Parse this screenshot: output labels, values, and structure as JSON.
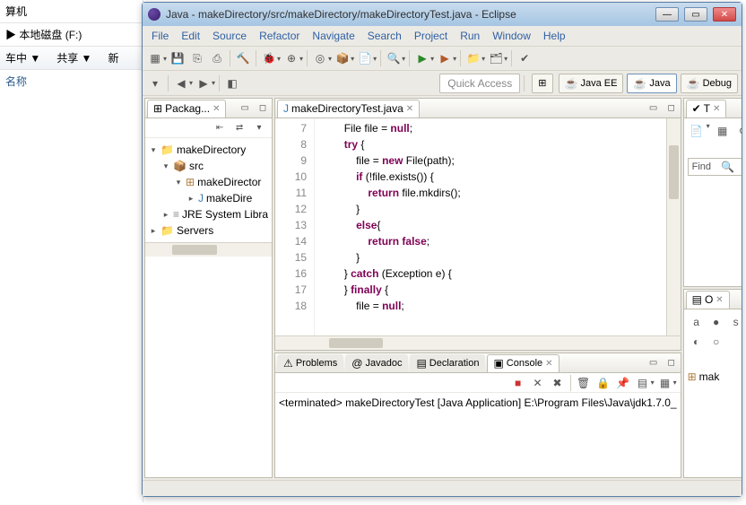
{
  "explorer": {
    "tab1": "算机",
    "breadcrumb_prefix": "▶",
    "breadcrumb": "本地磁盘 (F:)",
    "tool1": "车中 ▼",
    "tool2": "共享 ▼",
    "tool3": "新",
    "header": "名称"
  },
  "eclipse": {
    "title": "Java - makeDirectory/src/makeDirectory/makeDirectoryTest.java - Eclipse",
    "menu": [
      "File",
      "Edit",
      "Source",
      "Refactor",
      "Navigate",
      "Search",
      "Project",
      "Run",
      "Window",
      "Help"
    ],
    "quick_access": "Quick Access",
    "perspectives": [
      {
        "label": "Java EE",
        "active": false
      },
      {
        "label": "Java",
        "active": true
      },
      {
        "label": "Debug",
        "active": false
      }
    ],
    "package_view": {
      "title": "Packag...",
      "tree": {
        "root": "makeDirectory",
        "src": "src",
        "pkg": "makeDirector",
        "file": "makeDire",
        "jre": "JRE System Libra",
        "servers": "Servers"
      }
    },
    "editor": {
      "tab": "makeDirectoryTest.java",
      "code": [
        {
          "n": 7,
          "indent": 8,
          "tokens": [
            {
              "t": "File file = "
            },
            {
              "t": "null",
              "c": "kw"
            },
            {
              "t": ";"
            }
          ]
        },
        {
          "n": 8,
          "indent": 8,
          "tokens": [
            {
              "t": "try",
              "c": "kw"
            },
            {
              "t": " {"
            }
          ]
        },
        {
          "n": 9,
          "indent": 12,
          "tokens": [
            {
              "t": "file = "
            },
            {
              "t": "new",
              "c": "kw"
            },
            {
              "t": " File(path);"
            }
          ]
        },
        {
          "n": 10,
          "indent": 12,
          "tokens": [
            {
              "t": "if",
              "c": "kw"
            },
            {
              "t": " (!file.exists()) {"
            }
          ]
        },
        {
          "n": 11,
          "indent": 16,
          "tokens": [
            {
              "t": "return",
              "c": "kw"
            },
            {
              "t": " file.mkdirs();"
            }
          ]
        },
        {
          "n": 12,
          "indent": 12,
          "tokens": [
            {
              "t": "}"
            }
          ]
        },
        {
          "n": 13,
          "indent": 12,
          "tokens": [
            {
              "t": "else",
              "c": "kw"
            },
            {
              "t": "{"
            }
          ]
        },
        {
          "n": 14,
          "indent": 16,
          "tokens": [
            {
              "t": "return",
              "c": "kw"
            },
            {
              "t": " "
            },
            {
              "t": "false",
              "c": "lit"
            },
            {
              "t": ";"
            }
          ]
        },
        {
          "n": 15,
          "indent": 12,
          "tokens": [
            {
              "t": "}"
            }
          ]
        },
        {
          "n": 16,
          "indent": 8,
          "tokens": [
            {
              "t": "} "
            },
            {
              "t": "catch",
              "c": "kw"
            },
            {
              "t": " (Exception e) {"
            }
          ]
        },
        {
          "n": 17,
          "indent": 8,
          "tokens": [
            {
              "t": "} "
            },
            {
              "t": "finally",
              "c": "kw"
            },
            {
              "t": " {"
            }
          ]
        },
        {
          "n": 18,
          "indent": 12,
          "tokens": [
            {
              "t": "file = "
            },
            {
              "t": "null",
              "c": "kw"
            },
            {
              "t": ";"
            }
          ]
        }
      ]
    },
    "bottom_tabs": [
      "Problems",
      "Javadoc",
      "Declaration",
      "Console"
    ],
    "console_status": "<terminated> makeDirectoryTest [Java Application] E:\\Program Files\\Java\\jdk1.7.0_",
    "task_view_title": "T",
    "find_label": "Find",
    "outline_view_title": "O",
    "outline_item": "mak"
  }
}
